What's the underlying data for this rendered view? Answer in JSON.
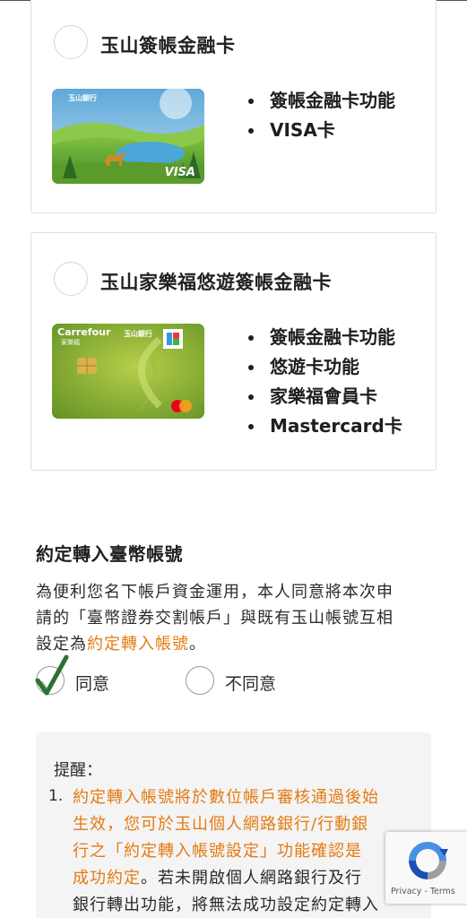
{
  "cards": [
    {
      "title": "玉山簽帳金融卡",
      "card_brand_text": "玉山銀行",
      "card_network_mark": "VISA",
      "features": [
        "簽帳金融卡功能",
        "VISA卡"
      ]
    },
    {
      "title": "玉山家樂福悠遊簽帳金融卡",
      "card_brand_text": "Carrefour",
      "card_brand_sub": "家樂福",
      "card_bank_text": "玉山銀行",
      "features": [
        "簽帳金融卡功能",
        "悠遊卡功能",
        "家樂福會員卡",
        "Mastercard卡"
      ]
    }
  ],
  "section": {
    "title": "約定轉入臺幣帳號",
    "desc_line1": "為便利您名下帳戶資金運用，本人同意將本次申",
    "desc_line2": "請的「臺幣證券交割帳戶」與既有玉山帳號互相",
    "desc_line3_prefix": "設定為",
    "desc_line3_link": "約定轉入帳號",
    "desc_line3_suffix": "。",
    "agree_label": "同意",
    "disagree_label": "不同意",
    "agree_selected": true
  },
  "reminder": {
    "title": "提醒：",
    "item_number": "1.",
    "line1": "約定轉入帳號將於數位帳戶審核通過後始",
    "line2": "生效，您可於玉山個人網路銀行/行動銀",
    "line3": "行之「約定轉入帳號設定」功能確認是",
    "line4_orange": "成功約定",
    "line4_rest": "。若未開啟個人網路銀行及行",
    "line5": "銀行轉出功能，將無法成功設定約定轉入"
  },
  "recaptcha": {
    "links": "Privacy - Terms"
  },
  "colors": {
    "accent_orange": "#e47a12",
    "border_gray": "#dedede",
    "reminder_bg": "#f4f4f4",
    "check_green": "#2f6f34"
  }
}
